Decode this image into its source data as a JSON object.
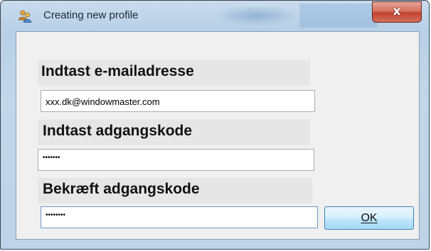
{
  "window": {
    "title": "Creating new profile",
    "close_glyph": "x"
  },
  "form": {
    "email_label": "Indtast e-mailadresse",
    "email_value": "xxx.dk@windowmaster.com",
    "password_label": "Indtast adgangskode",
    "password_value": "•••••••",
    "confirm_label": "Bekræft adgangskode",
    "confirm_value": "••••••••",
    "ok_label": "OK"
  },
  "icons": {
    "app": "users-icon",
    "close": "close-icon"
  },
  "colors": {
    "close_button": "#c7472f",
    "ok_border": "#3c7fb1",
    "client_bg": "#f0f0f0"
  }
}
